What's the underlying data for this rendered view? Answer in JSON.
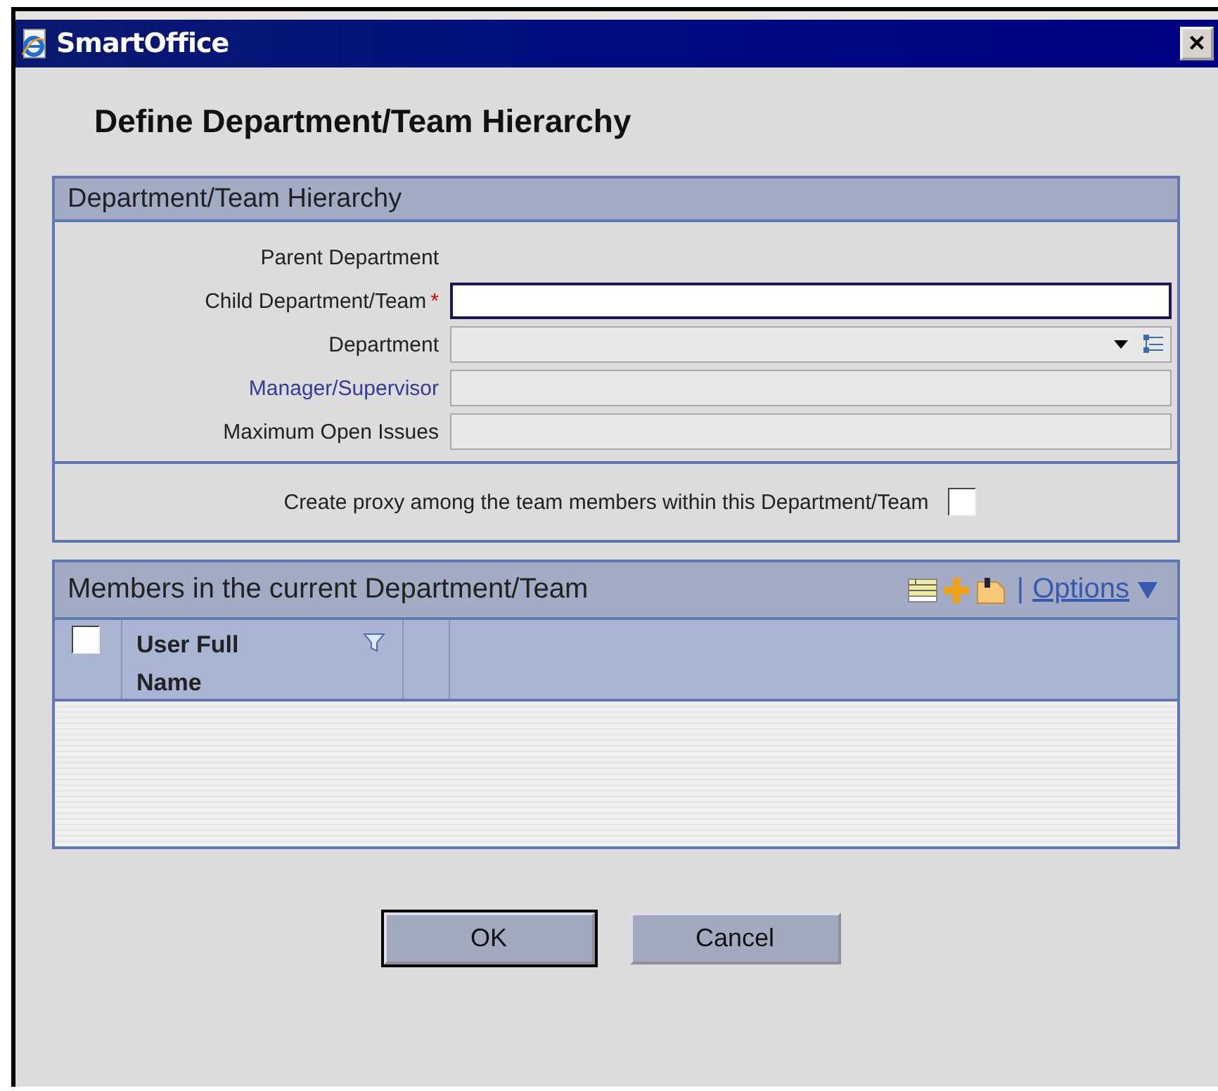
{
  "window": {
    "title": "SmartOffice",
    "close": "×"
  },
  "heading": "Define Department/Team Hierarchy",
  "hierarchy": {
    "title": "Department/Team Hierarchy",
    "fields": [
      {
        "label": "Parent Department",
        "kind": "static",
        "link": false
      },
      {
        "label": "Child Department/Team",
        "kind": "input",
        "required_mark": "*",
        "link": false
      },
      {
        "label": "Department",
        "kind": "select",
        "link": false
      },
      {
        "label": "Manager/Supervisor",
        "kind": "readonly",
        "link": true
      },
      {
        "label": "Maximum Open Issues",
        "kind": "readonly",
        "link": false
      }
    ],
    "proxy": {
      "label": "Create proxy among the team members within this Department/Team",
      "checked": false
    }
  },
  "members": {
    "title": "Members in the current Department/Team",
    "separator": "|",
    "options": "Options",
    "select_all": {
      "checked": false
    },
    "columns": [
      {
        "label": "User Full Name",
        "filter": true
      }
    ]
  },
  "buttons": [
    {
      "label": "OK",
      "default": true
    },
    {
      "label": "Cancel",
      "default": false
    }
  ]
}
